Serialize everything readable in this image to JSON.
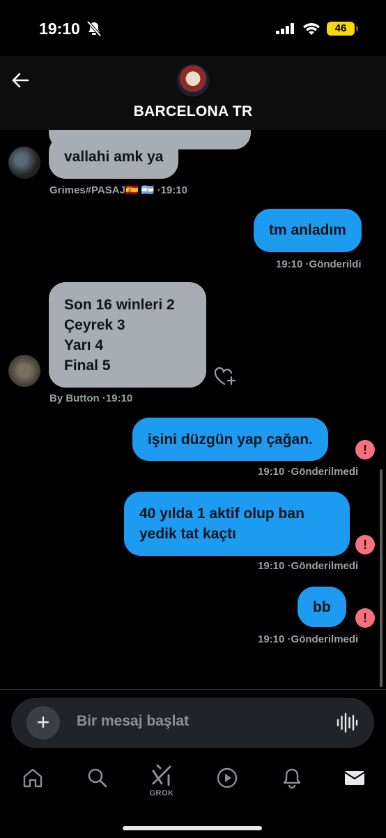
{
  "status_bar": {
    "time": "19:10",
    "battery": "46"
  },
  "header": {
    "title": "BARCELONA TR"
  },
  "messages": {
    "m1": {
      "text": "vallahi amk ya",
      "sender_meta": "Grimes#PASAJ🇪🇸 🇦🇷 ·19:10"
    },
    "m2": {
      "text": "tm anladım",
      "meta": "19:10 ·Gönderildi"
    },
    "m3": {
      "lines": [
        "Son 16 winleri 2",
        "Çeyrek 3",
        "Yarı 4",
        "Final 5"
      ],
      "sender_meta": "By Button ·19:10"
    },
    "m4": {
      "text": "işini düzgün yap çağan.",
      "meta": "19:10 ·Gönderilmedi"
    },
    "m5": {
      "lines": [
        "40 yılda 1 aktif olup ban",
        "yedik tat kaçtı"
      ],
      "meta": "19:10 ·Gönderilmedi"
    },
    "m6": {
      "text": "bb",
      "meta": "19:10 ·Gönderilmedi"
    },
    "error_glyph": "!"
  },
  "composer": {
    "placeholder": "Bir mesaj başlat",
    "plus_glyph": "+"
  },
  "tabbar": {
    "grok_label": "GROK"
  },
  "colors": {
    "outgoing": "#1d9bf0",
    "incoming": "#a8adb3",
    "error": "#f4727d"
  },
  "icons": [
    "back-arrow-icon",
    "bell-slash-icon",
    "signal-icon",
    "wifi-icon",
    "battery-icon",
    "heart-plus-icon",
    "voice-wave-icon",
    "home-icon",
    "search-icon",
    "grok-icon",
    "play-icon",
    "bell-icon",
    "mail-icon"
  ]
}
